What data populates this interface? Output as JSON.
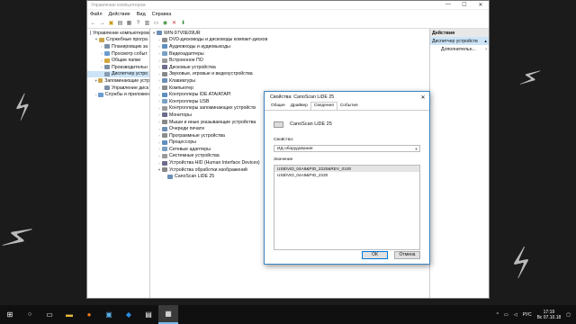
{
  "window": {
    "title": "Управление компьютером",
    "controls": [
      "—",
      "☐",
      "✕"
    ]
  },
  "menu": [
    "Файл",
    "Действие",
    "Вид",
    "Справка"
  ],
  "toolbar_icons": [
    "back-icon",
    "forward-icon",
    "up-icon",
    "view-icon",
    "properties-icon",
    "help-icon",
    "details-icon",
    "monitor-icon",
    "scan-icon",
    "disable-icon",
    "uninstall-icon",
    "update-icon"
  ],
  "left_tree": [
    {
      "label": "Управление компьютером",
      "level": 0,
      "twisty": ""
    },
    {
      "label": "Служебные програ",
      "level": 1,
      "twisty": "▾"
    },
    {
      "label": "Планировщик за",
      "level": 2,
      "twisty": "›"
    },
    {
      "label": "Просмотр событ",
      "level": 2,
      "twisty": "›"
    },
    {
      "label": "Общие папки",
      "level": 2,
      "twisty": "›"
    },
    {
      "label": "Производительн",
      "level": 2,
      "twisty": "›"
    },
    {
      "label": "Диспетчер устро",
      "level": 2,
      "twisty": "",
      "selected": true
    },
    {
      "label": "Запоминающие устр",
      "level": 1,
      "twisty": "▾"
    },
    {
      "label": "Управление диск",
      "level": 2,
      "twisty": ""
    },
    {
      "label": "Службы и приложен",
      "level": 1,
      "twisty": "›"
    }
  ],
  "device_tree": [
    {
      "label": "WIN-97V0E09UR",
      "level": 0,
      "twisty": "▾"
    },
    {
      "label": "DVD-дисководы и дисководы компакт-дисков",
      "level": 1,
      "twisty": "›"
    },
    {
      "label": "Аудиовходы и аудиовыходы",
      "level": 1,
      "twisty": "›"
    },
    {
      "label": "Видеоадаптеры",
      "level": 1,
      "twisty": "›"
    },
    {
      "label": "Встроенное ПО",
      "level": 1,
      "twisty": "›"
    },
    {
      "label": "Дисковые устройства",
      "level": 1,
      "twisty": "›"
    },
    {
      "label": "Звуковые, игровые и видеоустройства",
      "level": 1,
      "twisty": "›"
    },
    {
      "label": "Клавиатуры",
      "level": 1,
      "twisty": "›"
    },
    {
      "label": "Компьютер",
      "level": 1,
      "twisty": "›"
    },
    {
      "label": "Контроллеры IDE ATA/ATAPI",
      "level": 1,
      "twisty": "›"
    },
    {
      "label": "Контроллеры USB",
      "level": 1,
      "twisty": "›"
    },
    {
      "label": "Контроллеры запоминающих устройств",
      "level": 1,
      "twisty": "›"
    },
    {
      "label": "Мониторы",
      "level": 1,
      "twisty": "›"
    },
    {
      "label": "Мыши и иные указывающие устройства",
      "level": 1,
      "twisty": "›"
    },
    {
      "label": "Очереди печати",
      "level": 1,
      "twisty": "›"
    },
    {
      "label": "Программные устройства",
      "level": 1,
      "twisty": "›"
    },
    {
      "label": "Процессоры",
      "level": 1,
      "twisty": "›"
    },
    {
      "label": "Сетевые адаптеры",
      "level": 1,
      "twisty": "›"
    },
    {
      "label": "Системные устройства",
      "level": 1,
      "twisty": "›"
    },
    {
      "label": "Устройства HID (Human Interface Devices)",
      "level": 1,
      "twisty": "›"
    },
    {
      "label": "Устройства обработки изображений",
      "level": 1,
      "twisty": "▾"
    },
    {
      "label": "CanoScan LiDE 25",
      "level": 2,
      "twisty": ""
    }
  ],
  "actions": {
    "header": "Действия",
    "items": [
      {
        "label": "Диспетчер устройств",
        "arrow": "▴",
        "selected": true
      },
      {
        "label": "Дополнительн...",
        "arrow": "›"
      }
    ]
  },
  "dialog": {
    "title": "Свойства: CanoScan LiDE 25",
    "tabs": [
      "Общие",
      "Драйвер",
      "Сведения",
      "События"
    ],
    "active_tab": 2,
    "device_name": "CanoScan LiDE 25",
    "property_label": "Свойство:",
    "property_value": "ИД оборудования",
    "value_label": "Значение",
    "values": [
      "USB\\VID_04A9&PID_2220&REV_0100",
      "USB\\VID_04A9&PID_2220"
    ],
    "ok": "ОК",
    "cancel": "Отмена"
  },
  "taskbar": {
    "apps": [
      "windows-start-icon",
      "search-icon",
      "task-view-icon",
      "explorer-icon",
      "firefox-icon",
      "network-app-icon",
      "teamviewer-icon",
      "computer-management-icon",
      "device-manager-icon"
    ],
    "lang": "РУС",
    "time": "17:19",
    "date": "Вс 07.10.18"
  }
}
